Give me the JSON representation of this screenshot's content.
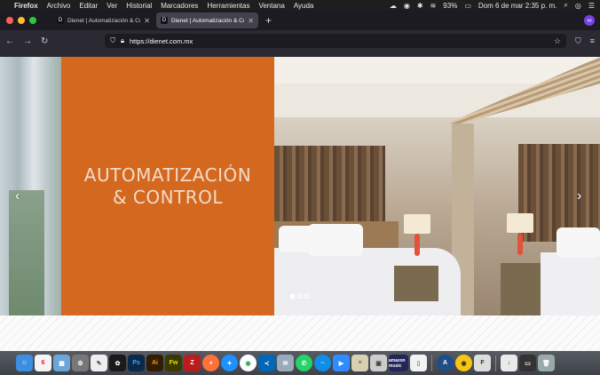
{
  "menubar": {
    "app_name": "Firefox",
    "items": [
      "Archivo",
      "Editar",
      "Ver",
      "Historial",
      "Marcadores",
      "Herramientas",
      "Ventana",
      "Ayuda"
    ],
    "battery": "93%",
    "datetime": "Dom 6 de mar  2:35 p. m."
  },
  "tabs": [
    {
      "title": "Dienet | Automatización & Contr",
      "active": false
    },
    {
      "title": "Dienet | Automatización & Contr",
      "active": true
    }
  ],
  "urlbar": {
    "url": "https://dienet.com.mx"
  },
  "hero": {
    "line1": "AUTOMATIZACIÓN",
    "line2": "& CONTROL",
    "accent_color": "#d4681f",
    "slides": 3,
    "active_slide": 1,
    "prev_arrow": "‹",
    "next_arrow": "›"
  },
  "dock": {
    "calendar_day": "6",
    "music_label": "amazon music",
    "icons": [
      "finder",
      "calendar",
      "preview",
      "system-preferences",
      "textedit",
      "chatgpt",
      "photoshop",
      "illustrator",
      "fireworks",
      "filezilla",
      "firefox",
      "safari",
      "chrome",
      "vscode",
      "mail",
      "whatsapp",
      "teamviewer",
      "zoom",
      "notes",
      "photos",
      "amazon-music",
      "document",
      "mac-app",
      "chrome-canary",
      "font",
      "download",
      "screen",
      "trash"
    ]
  }
}
